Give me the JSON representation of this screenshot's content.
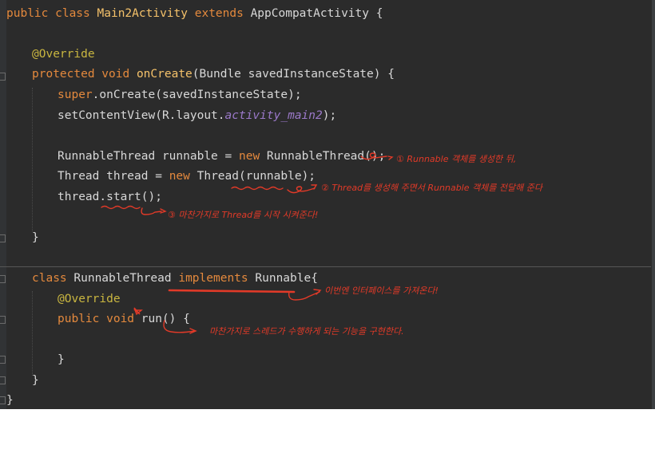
{
  "code": {
    "l1": {
      "kw1": "public class ",
      "fn": "Main2Activity",
      "kw2": " extends ",
      "pl": "AppCompatActivity {"
    },
    "l2": {
      "an": "@Override"
    },
    "l3": {
      "kw": "protected void ",
      "fn": "onCreate",
      "pl": "(Bundle savedInstanceState) {"
    },
    "l4": {
      "kw": "super",
      "pl": ".onCreate(savedInstanceState);"
    },
    "l5": {
      "pl1": "setContentView(R.layout.",
      "it": "activity_main2",
      "pl2": ");"
    },
    "l6": {
      "pl1": "RunnableThread runnable = ",
      "kw": "new",
      "pl2": " RunnableThread();"
    },
    "l7": {
      "pl1": "Thread thread = ",
      "kw": "new",
      "pl2": " Thread(runnable);"
    },
    "l8": {
      "pl": "thread.start();"
    },
    "l9": {
      "pl": "}"
    },
    "l10": {
      "kw": "class ",
      "pl1": "RunnableThread ",
      "kw2": "implements",
      "pl2": " Runnable{"
    },
    "l11": {
      "an": "@Override"
    },
    "l12": {
      "kw": "public void ",
      "pl": "run() {"
    },
    "l13": {
      "pl": "}"
    },
    "l14": {
      "pl": "}"
    },
    "l15": {
      "pl": "}"
    }
  },
  "annotations": {
    "n1": "① Runnable 객체를 생성한 뒤,",
    "n2": "② Thread를 생성해 주면서 Runnable 객체를 전달해 준다",
    "n3": "③ 마찬가지로 Thread를 시작 시켜준다!",
    "n4": "이번엔 인터페이스를 가져온다!",
    "n5": "마찬가지로 스레드가 수행하게 되는 기능을 구현한다."
  },
  "colors": {
    "background": "#2b2b2b",
    "keyword": "#e4893d",
    "function": "#f5c26a",
    "annotation": "#c9b640",
    "text": "#d8d8d8",
    "ink": "#e23a28"
  }
}
